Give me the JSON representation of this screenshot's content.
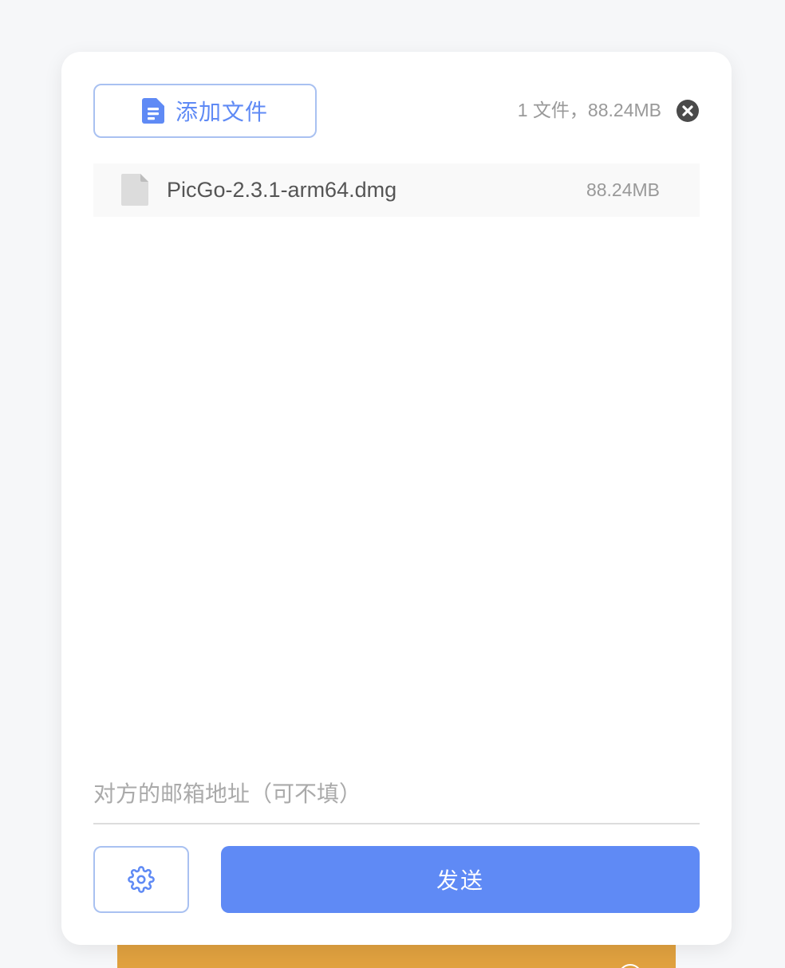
{
  "colors": {
    "accent": "#5f8af5",
    "accent_border": "#a9c1f1",
    "banner": "#e0a13f",
    "muted_text": "#999999"
  },
  "header": {
    "add_file_label": "添加文件",
    "add_file_icon": "document-icon",
    "summary": "1 文件，88.24MB",
    "clear_icon": "close-circle-icon"
  },
  "files": [
    {
      "name": "PicGo-2.3.1-arm64.dmg",
      "size": "88.24MB",
      "icon": "file-icon"
    }
  ],
  "email": {
    "placeholder": "对方的邮箱地址（可不填）",
    "value": ""
  },
  "footer": {
    "settings_icon": "gear-icon",
    "send_label": "发送"
  }
}
